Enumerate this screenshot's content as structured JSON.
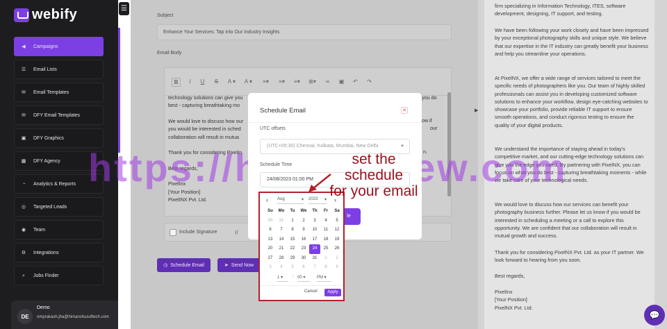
{
  "app": {
    "name": "webify"
  },
  "sidebar": {
    "items": [
      {
        "label": "Campaigns",
        "icon": "megaphone-icon"
      },
      {
        "label": "Email Lists",
        "icon": "list-icon"
      },
      {
        "label": "Email Templates",
        "icon": "envelope-icon"
      },
      {
        "label": "DFY Email Templates",
        "icon": "envelope-icon"
      },
      {
        "label": "DFY Graphics",
        "icon": "image-icon"
      },
      {
        "label": "DFY Agency",
        "icon": "briefcase-icon"
      },
      {
        "label": "Analytics & Reports",
        "icon": "chart-icon"
      },
      {
        "label": "Targeted Leads",
        "icon": "target-icon"
      },
      {
        "label": "Team",
        "icon": "team-icon"
      },
      {
        "label": "Integrations",
        "icon": "plug-icon"
      },
      {
        "label": "Jobs Finder",
        "icon": "search-icon"
      }
    ]
  },
  "user": {
    "initials": "DE",
    "name": "Demo",
    "email": "omprakash.jha@himanshusoftech.com"
  },
  "form": {
    "subject_label": "Subject",
    "subject_value": "Enhance Your Services: Tap into Our Industry Insights",
    "body_label": "Email Body",
    "body_lines": [
      "technology solutions can give you",
      "best - capturing breathtaking mo",
      "",
      "We would love to discuss how our",
      "you would be interested in sched",
      "collaboration will result in mutua",
      "",
      "Thank you for considering PixelIn",
      "",
      "Best regards,",
      "",
      "PixelInx",
      "[Your Position]",
      "PixelINX Pvt. Ltd."
    ],
    "body_right_fragments": [
      "you do",
      "ow if",
      "our",
      "n."
    ],
    "include_signature": "Include Signature",
    "schedule_button": "Schedule Email",
    "send_button": "Send Now"
  },
  "modal": {
    "title": "Schedule Email",
    "utc_label": "UTC offsets",
    "utc_value": "(UTC+05:30) Chennai, Kolkata, Mumbai, New Delhi",
    "time_label": "Schedule Time",
    "time_value": "24/08/2023 01:00 PM",
    "submit_label": "le"
  },
  "calendar": {
    "month": "Aug",
    "year": "2023",
    "weekdays": [
      "Su",
      "Mo",
      "Tu",
      "We",
      "Th",
      "Fr",
      "Sa"
    ],
    "weeks": [
      [
        "30",
        "31",
        "1",
        "2",
        "3",
        "4",
        "5"
      ],
      [
        "6",
        "7",
        "8",
        "9",
        "10",
        "11",
        "12"
      ],
      [
        "13",
        "14",
        "15",
        "16",
        "17",
        "18",
        "19"
      ],
      [
        "20",
        "21",
        "22",
        "23",
        "24",
        "25",
        "26"
      ],
      [
        "27",
        "28",
        "29",
        "30",
        "31",
        "1",
        "2"
      ],
      [
        "3",
        "4",
        "5",
        "6",
        "7",
        "8",
        "9"
      ]
    ],
    "selected_day": "24",
    "hour": "1",
    "minute": "00",
    "ampm": "PM",
    "cancel": "Cancel",
    "apply": "Apply"
  },
  "annotation": {
    "line1": "set the schedule",
    "line2": "for your email"
  },
  "watermark": "https://hudareview.com",
  "preview": {
    "paragraphs": [
      "firm specializing in Information Technology, ITES, software development, designing, IT support, and testing.",
      "We have been following your work closely and have been impressed by your exceptional photography skills and unique style. We believe that our expertise in the IT industry can greatly benefit your business and help you streamline your operations.",
      "At PixelNX, we offer a wide range of services tailored to meet the specific needs of photographers like you. Our team of highly skilled professionals can assist you in developing customized software solutions to enhance your workflow, design eye-catching websites to showcase your portfolio, provide reliable IT support to ensure smooth operations, and conduct rigorous testing to ensure the quality of your digital products.",
      "We understand the importance of staying ahead in today's competitive market, and our cutting-edge technology solutions can give you the edge you need. By partnering with PixelNX, you can focus on what you do best - capturing breathtaking moments - while we take care of your technological needs.",
      "We would love to discuss how our services can benefit your photography business further. Please let us know if you would be interested in scheduling a meeting or a call to explore this opportunity. We are confident that our collaboration will result in mutual growth and success.",
      "Thank you for considering PixelNX Pvt. Ltd. as your IT partner. We look forward to hearing from you soon.",
      "Best regards,",
      "PixelInx\n[Your Position]\nPixelNX Pvt. Ltd."
    ]
  },
  "colors": {
    "accent": "#7b3fe4",
    "sidebar_bg": "#1d1d20",
    "annotation": "#b3202a"
  }
}
